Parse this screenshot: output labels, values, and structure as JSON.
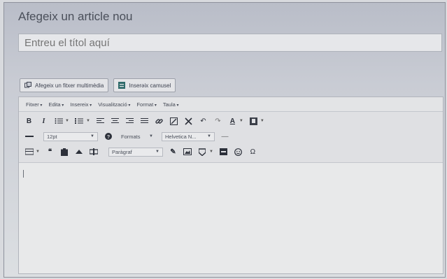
{
  "page": {
    "heading": "Afegeix un article nou",
    "title_placeholder": "Entreu el títol aquí"
  },
  "media": {
    "add_media_label": "Afegeix un fitxer multimèdia",
    "insert_form_label": "Inserəix camusel"
  },
  "menubar": {
    "items": [
      "Fitxer",
      "Edita",
      "Insereix",
      "Visualització",
      "Format",
      "Taula"
    ]
  },
  "toolbar": {
    "font_size": "12pt",
    "formats_label": "Formats",
    "font_family": "Helvetica N...",
    "block_format": "Paràgraf"
  }
}
